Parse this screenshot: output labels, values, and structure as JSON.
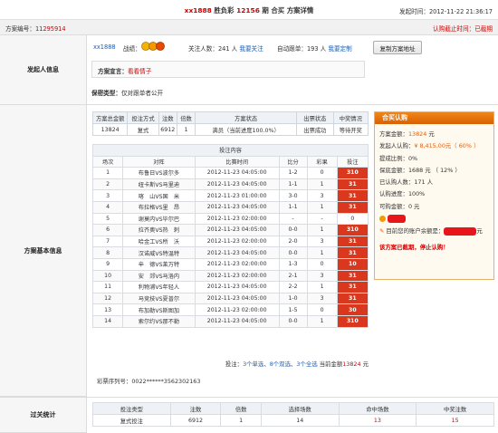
{
  "header": {
    "user": "xx1888",
    "game": "胜负彩",
    "period": "12156",
    "period_suffix": "期",
    "title_suffix": "合买 方案详情",
    "publish_label": "发起时间：",
    "publish_time": "2012-11-22 21:36:17"
  },
  "subbar": {
    "plan_label": "方案编号：",
    "plan_no": "11295914",
    "status": "认购截止时间：已截期"
  },
  "sponsor": {
    "section_label": "发起人信息",
    "username": "xx1888",
    "record_label": "战绩：",
    "followers_label": "关注人数：",
    "followers_count": "241",
    "followers_unit": "人",
    "follow_link": "我要关注",
    "auto_label": "自动跟单：",
    "auto_count": "193",
    "auto_unit": "人",
    "custom_link": "我要定制",
    "copy_button": "复制方案地址",
    "declaration_label": "方案宣言：",
    "declaration": "看看情子",
    "secrecy_label": "保密类型：",
    "secrecy": "仅对跟单者公开"
  },
  "plan": {
    "section_label": "方案基本信息",
    "info_headers": [
      "方案总金额",
      "投注方式",
      "注数",
      "倍数",
      "方案状态",
      "出票状态",
      "中奖情况"
    ],
    "info_values": [
      "13824",
      "复式",
      "6912",
      "1",
      "满员（当前进度100.0%）",
      "出票成功",
      "等待开奖"
    ],
    "picks_title": "投注内容",
    "picks_headers": [
      "场次",
      "对阵",
      "比赛时间",
      "比分",
      "彩果",
      "投注"
    ],
    "matches": [
      {
        "no": "1",
        "teams": "布鲁日VS波尔多",
        "time": "2012-11-23 04:05:00",
        "score": "1-2",
        "result": "0",
        "pick": "310"
      },
      {
        "no": "2",
        "teams": "纽卡斯VS马里迪",
        "time": "2012-11-23 04:05:00",
        "score": "1-1",
        "result": "1",
        "pick": "31"
      },
      {
        "no": "3",
        "teams": "喀　山VS国　米",
        "time": "2012-11-23 01:00:00",
        "score": "3-0",
        "result": "3",
        "pick": "31"
      },
      {
        "no": "4",
        "teams": "布拉格VS里　昂",
        "time": "2012-11-23 04:05:00",
        "score": "1-1",
        "result": "1",
        "pick": "31"
      },
      {
        "no": "5",
        "teams": "谢莫内VS毕尔巴",
        "time": "2012-11-23 02:00:00",
        "score": "-",
        "result": "-",
        "pick": "0"
      },
      {
        "no": "6",
        "teams": "拉齐奥VS热　刺",
        "time": "2012-11-23 04:05:00",
        "score": "0-0",
        "result": "1",
        "pick": "310"
      },
      {
        "no": "7",
        "teams": "哈金工VS所　沃",
        "time": "2012-11-23 02:00:00",
        "score": "2-0",
        "result": "3",
        "pick": "31"
      },
      {
        "no": "8",
        "teams": "汉诺威VS特温特",
        "time": "2012-11-23 04:05:00",
        "score": "0-0",
        "result": "1",
        "pick": "31"
      },
      {
        "no": "9",
        "teams": "辛　德VS莱万特",
        "time": "2012-11-23 02:00:00",
        "score": "1-3",
        "result": "0",
        "pick": "10"
      },
      {
        "no": "10",
        "teams": "安　郊VS马洛内",
        "time": "2012-11-23 02:00:00",
        "score": "2-1",
        "result": "3",
        "pick": "31"
      },
      {
        "no": "11",
        "teams": "利物浦VS年轻人",
        "time": "2012-11-23 04:05:00",
        "score": "2-2",
        "result": "1",
        "pick": "31"
      },
      {
        "no": "12",
        "teams": "马竞技VS夏普尔",
        "time": "2012-11-23 04:05:00",
        "score": "1-0",
        "result": "3",
        "pick": "31"
      },
      {
        "no": "13",
        "teams": "布加勒VS斯图加",
        "time": "2012-11-23 02:00:00",
        "score": "1-5",
        "result": "0",
        "pick": "30"
      },
      {
        "no": "14",
        "teams": "索尔约VS那不勒",
        "time": "2012-11-23 04:05:00",
        "score": "0-0",
        "result": "1",
        "pick": "310"
      }
    ],
    "summary_prefix": "投注：",
    "summary_single": "3个单选",
    "summary_double": "8个双选",
    "summary_triple": "3个全选",
    "summary_amount_label": "当前金额",
    "summary_amount": "13824",
    "summary_unit": "元",
    "serial_label": "彩票序列号：",
    "serial": "0022******3562302163"
  },
  "buy_panel": {
    "title": "合买认购",
    "total_label": "方案金额：",
    "total_value": "13824",
    "total_unit": "元",
    "sponsor_buy_label": "发起人认购：",
    "sponsor_buy_value": "¥ 8,415.00元",
    "sponsor_buy_pct": "（ 60% ）",
    "commission_label": "提成比例：",
    "commission_value": "0%",
    "guarantee_label": "保底金额：",
    "guarantee_value": "1688 元 （ 12% ）",
    "buyers_label": "已认购人数：",
    "buyers_value": "171 人",
    "progress_label": "认购进度：",
    "progress_value": "100%",
    "available_label": "可购金额：",
    "available_value": "0 元",
    "balance_label": "目前您的账户余额是：",
    "balance_unit": "元",
    "closed_notice": "该方案已截期，停止认购！"
  },
  "stats": {
    "section_label": "过关统计",
    "headers": [
      "投注类型",
      "注数",
      "倍数",
      "选择场数",
      "命中场数",
      "中奖注数"
    ],
    "row": [
      "复式投注",
      "6912",
      "1",
      "14",
      "13",
      "15"
    ]
  },
  "colors": {
    "accent_red": "#d40000",
    "pick_cell": "#d9381e",
    "panel_orange": "#d95f00",
    "link_blue": "#1a5fb4"
  }
}
